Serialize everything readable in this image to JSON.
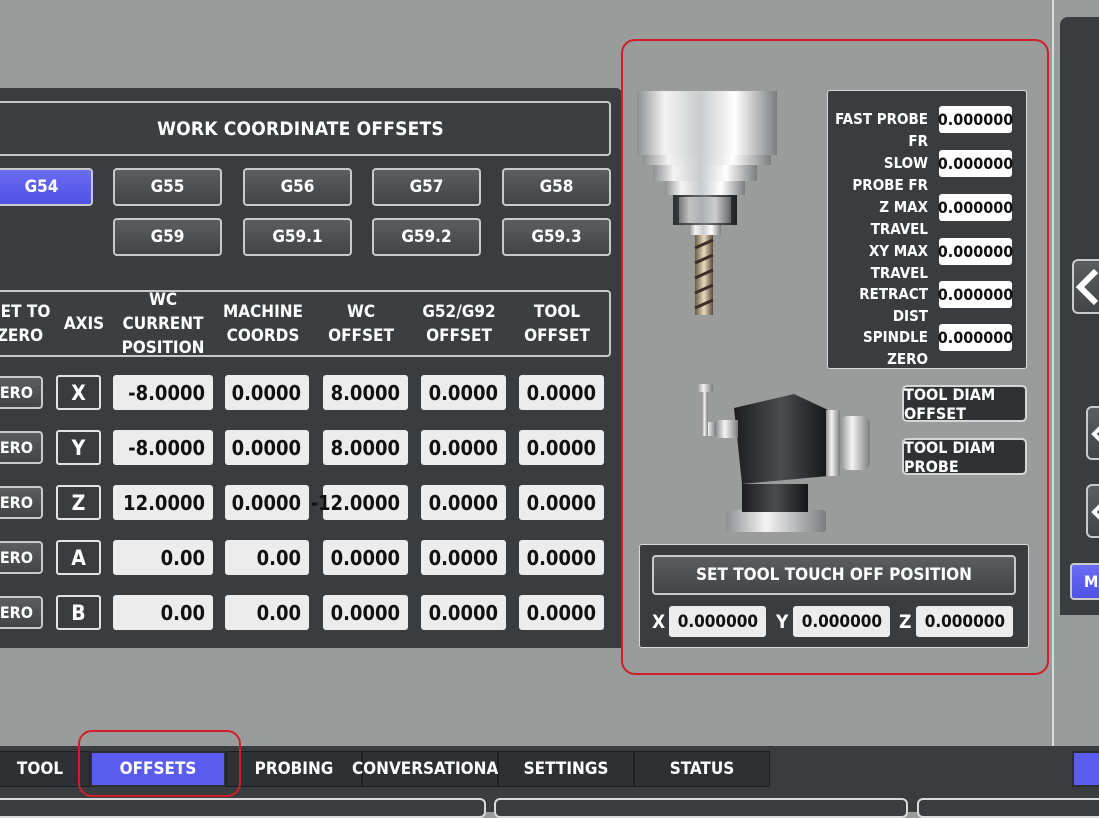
{
  "wco": {
    "title": "WORK COORDINATE OFFSETS",
    "offsets_row1": [
      "G54",
      "G55",
      "G56",
      "G57",
      "G58"
    ],
    "offsets_row2": [
      "G59",
      "G59.1",
      "G59.2",
      "G59.3"
    ],
    "active_offset": "G54",
    "columns": {
      "set_to_zero": [
        "SET TO",
        "ZERO"
      ],
      "axis": "AXIS",
      "wc_current_position": [
        "WC CURRENT",
        "POSITION"
      ],
      "machine_coords": [
        "MACHINE",
        "COORDS"
      ],
      "wc_offset": [
        "WC",
        "OFFSET"
      ],
      "g52_g92_offset": [
        "G52/G92",
        "OFFSET"
      ],
      "tool_offset": [
        "TOOL",
        "OFFSET"
      ]
    },
    "zero_label": "ZERO",
    "rows": [
      {
        "axis": "X",
        "wc": "-8.0000",
        "machine": "0.0000",
        "wcoff": "8.0000",
        "g52": "0.0000",
        "tool": "0.0000"
      },
      {
        "axis": "Y",
        "wc": "-8.0000",
        "machine": "0.0000",
        "wcoff": "8.0000",
        "g52": "0.0000",
        "tool": "0.0000"
      },
      {
        "axis": "Z",
        "wc": "12.0000",
        "machine": "0.0000",
        "wcoff": "-12.0000",
        "g52": "0.0000",
        "tool": "0.0000"
      },
      {
        "axis": "A",
        "wc": "0.00",
        "machine": "0.00",
        "wcoff": "0.0000",
        "g52": "0.0000",
        "tool": "0.0000"
      },
      {
        "axis": "B",
        "wc": "0.00",
        "machine": "0.00",
        "wcoff": "0.0000",
        "g52": "0.0000",
        "tool": "0.0000"
      }
    ]
  },
  "probe": {
    "params": [
      {
        "label": "FAST PROBE FR",
        "value": "0.000000"
      },
      {
        "label": "SLOW PROBE FR",
        "value": "0.000000"
      },
      {
        "label": "Z MAX TRAVEL",
        "value": "0.000000"
      },
      {
        "label": "XY MAX TRAVEL",
        "value": "0.000000"
      },
      {
        "label": "RETRACT DIST",
        "value": "0.000000"
      },
      {
        "label": "SPINDLE ZERO",
        "value": "0.000000"
      }
    ],
    "tool_diam_offset": "TOOL DIAM OFFSET",
    "tool_diam_probe": "TOOL DIAM PROBE",
    "set_touch_off": "SET TOOL TOUCH OFF POSITION",
    "touch": {
      "x_label": "X",
      "x": "0.000000",
      "y_label": "Y",
      "y": "0.000000",
      "z_label": "Z",
      "z": "0.000000"
    }
  },
  "edge": {
    "partial_label": "MA"
  },
  "tabs": {
    "items": [
      "TOOL",
      "OFFSETS",
      "PROBING",
      "CONVERSATIONAL",
      "SETTINGS",
      "STATUS"
    ],
    "active": "OFFSETS"
  },
  "colors": {
    "accent": "#5a5cf0",
    "highlight": "#d01e2a",
    "panel": "#3a3d3f",
    "background": "#9a9c9b"
  }
}
